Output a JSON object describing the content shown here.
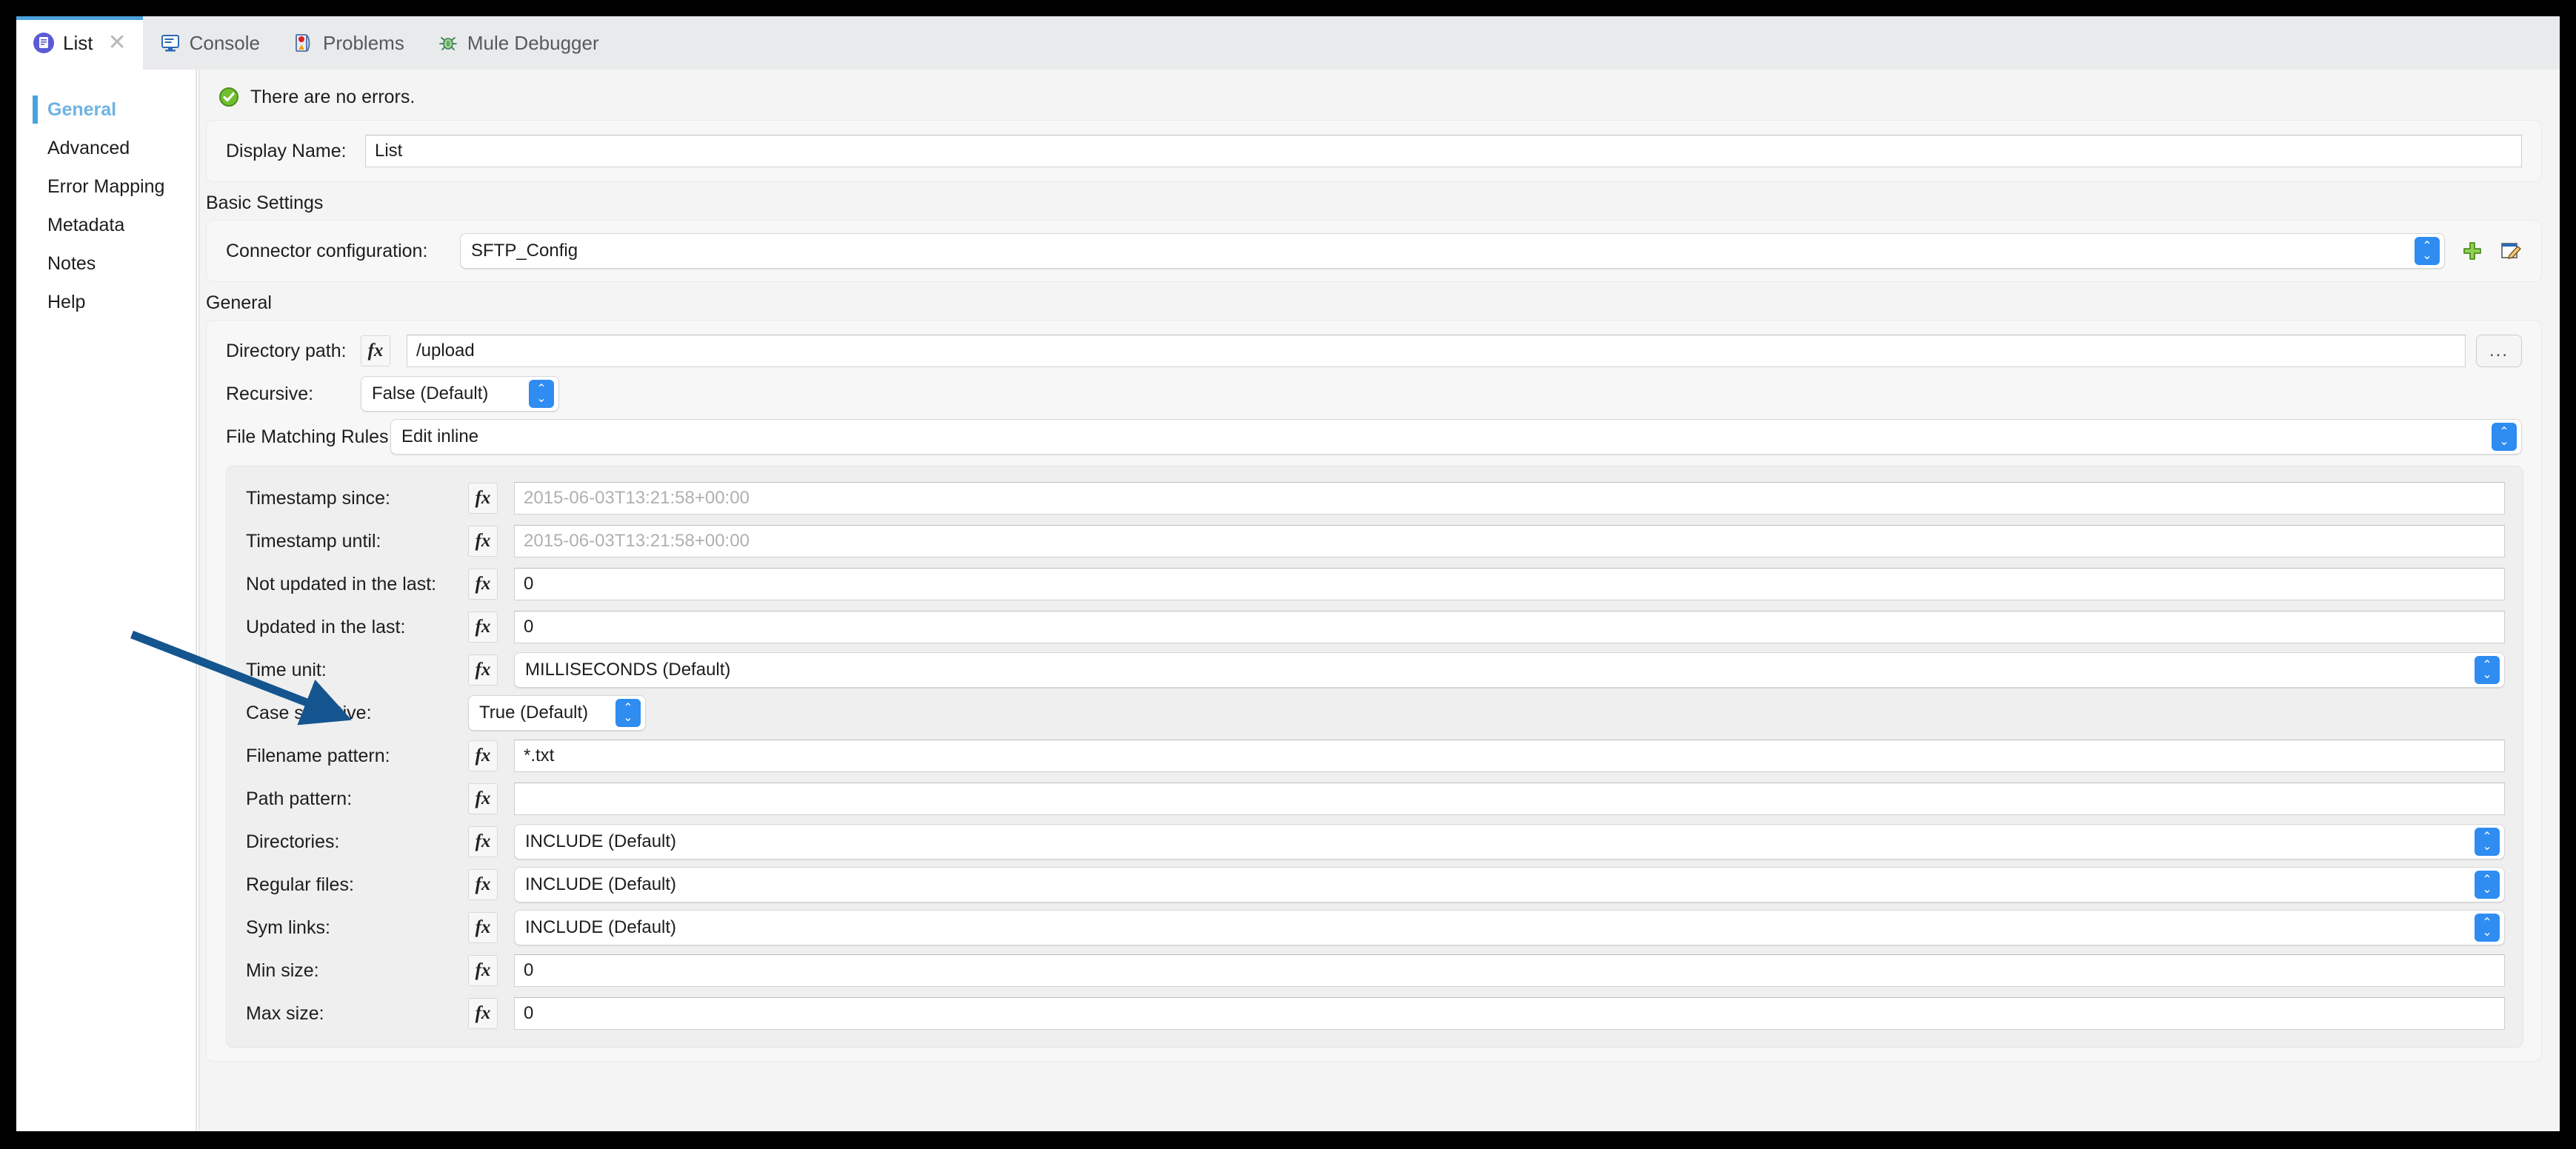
{
  "window": {
    "tabs": [
      {
        "label": "List",
        "icon": "sftp-list-icon",
        "active": true,
        "closable": true
      },
      {
        "label": "Console",
        "icon": "console-icon",
        "active": false,
        "closable": false
      },
      {
        "label": "Problems",
        "icon": "problems-icon",
        "active": false,
        "closable": false
      },
      {
        "label": "Mule Debugger",
        "icon": "bug-icon",
        "active": false,
        "closable": false
      }
    ]
  },
  "sidebar": {
    "items": [
      {
        "label": "General",
        "active": true
      },
      {
        "label": "Advanced",
        "active": false
      },
      {
        "label": "Error Mapping",
        "active": false
      },
      {
        "label": "Metadata",
        "active": false
      },
      {
        "label": "Notes",
        "active": false
      },
      {
        "label": "Help",
        "active": false
      }
    ]
  },
  "status": {
    "icon": "success-check-icon",
    "text": "There are no errors."
  },
  "display_name": {
    "label": "Display Name:",
    "value": "List"
  },
  "basic_settings": {
    "title": "Basic Settings",
    "connector_config": {
      "label": "Connector configuration:",
      "value": "SFTP_Config",
      "add_icon": "plus-icon",
      "edit_icon": "edit-icon"
    }
  },
  "general": {
    "title": "General",
    "directory_path": {
      "label": "Directory path:",
      "fx": "fx",
      "value": "/upload",
      "browse_label": "..."
    },
    "recursive": {
      "label": "Recursive:",
      "value": "False (Default)"
    },
    "file_matching_rules": {
      "label": "File Matching Rules",
      "value": "Edit inline"
    },
    "rules": [
      {
        "label": "Timestamp since:",
        "fx": "fx",
        "type": "text",
        "value": "",
        "placeholder": "2015-06-03T13:21:58+00:00"
      },
      {
        "label": "Timestamp until:",
        "fx": "fx",
        "type": "text",
        "value": "",
        "placeholder": "2015-06-03T13:21:58+00:00"
      },
      {
        "label": "Not updated in the last:",
        "fx": "fx",
        "type": "text",
        "value": "0",
        "placeholder": ""
      },
      {
        "label": "Updated in the last:",
        "fx": "fx",
        "type": "text",
        "value": "0",
        "placeholder": ""
      },
      {
        "label": "Time unit:",
        "fx": "fx",
        "type": "combo",
        "value": "MILLISECONDS (Default)",
        "placeholder": ""
      },
      {
        "label": "Case sensitive:",
        "fx": "",
        "type": "combo-small",
        "value": "True (Default)",
        "placeholder": ""
      },
      {
        "label": "Filename pattern:",
        "fx": "fx",
        "type": "text",
        "value": "*.txt",
        "placeholder": ""
      },
      {
        "label": "Path pattern:",
        "fx": "fx",
        "type": "text",
        "value": "",
        "placeholder": ""
      },
      {
        "label": "Directories:",
        "fx": "fx",
        "type": "combo",
        "value": "INCLUDE (Default)",
        "placeholder": ""
      },
      {
        "label": "Regular files:",
        "fx": "fx",
        "type": "combo",
        "value": "INCLUDE (Default)",
        "placeholder": ""
      },
      {
        "label": "Sym links:",
        "fx": "fx",
        "type": "combo",
        "value": "INCLUDE (Default)",
        "placeholder": ""
      },
      {
        "label": "Min size:",
        "fx": "fx",
        "type": "text",
        "value": "0",
        "placeholder": ""
      },
      {
        "label": "Max size:",
        "fx": "fx",
        "type": "text",
        "value": "0",
        "placeholder": ""
      }
    ]
  },
  "annotation": {
    "type": "arrow",
    "color": "#14558f",
    "points_to": "Case sensitive:"
  },
  "colors": {
    "accent": "#4aa3df",
    "stepper_blue": "#2f8cf0",
    "active_nav": "#6db3e2",
    "annotation": "#14558f",
    "success_green": "#6fbf2f"
  }
}
